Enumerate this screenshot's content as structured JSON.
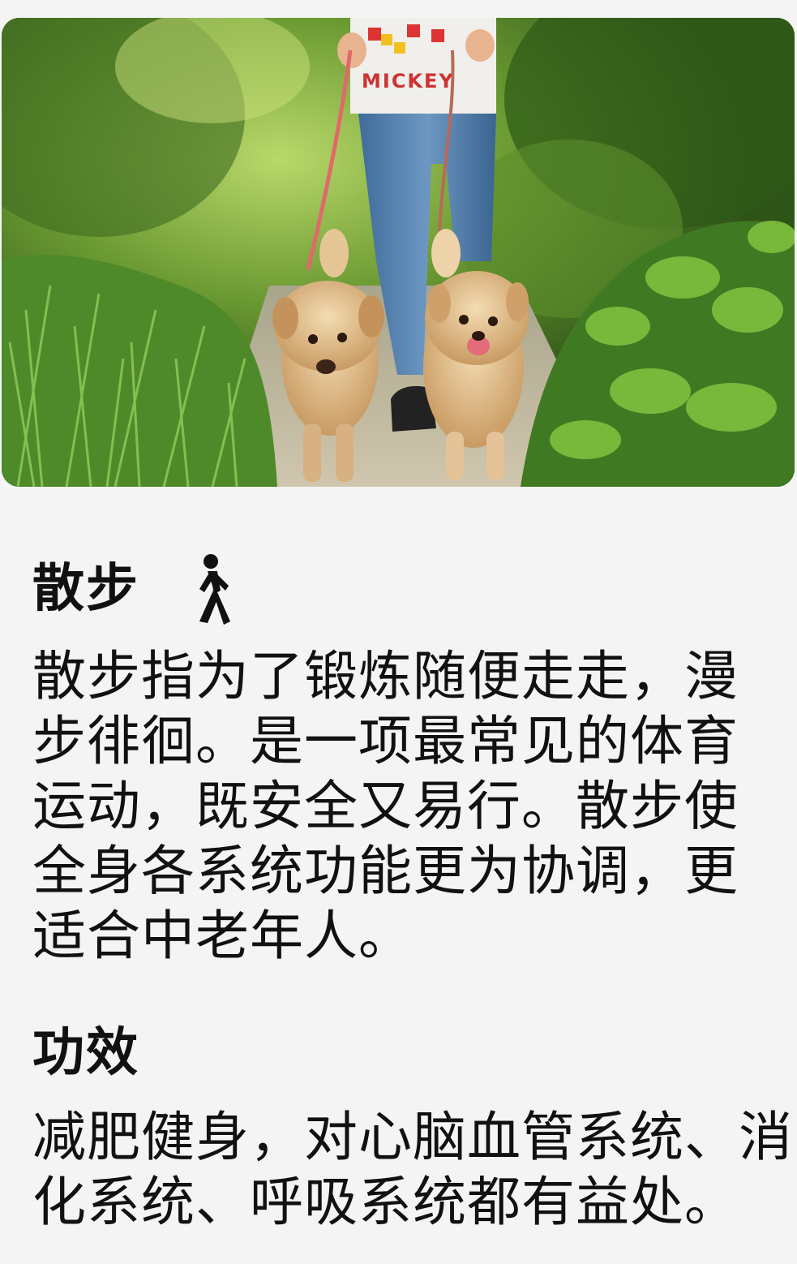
{
  "hero_image": {
    "shirt_text": "MICKEY"
  },
  "walk_section": {
    "title": "散步",
    "icon": "walking-person-icon",
    "description": "散步指为了锻炼随便走走，漫步徘徊。是一项最常见的体育运动，既安全又易行。散步使全身各系统功能更为协调，更适合中老年人。"
  },
  "effect_section": {
    "title": "功效",
    "description": "减肥健身，对心脑血管系统、消化系统、呼吸系统都有益处。"
  }
}
